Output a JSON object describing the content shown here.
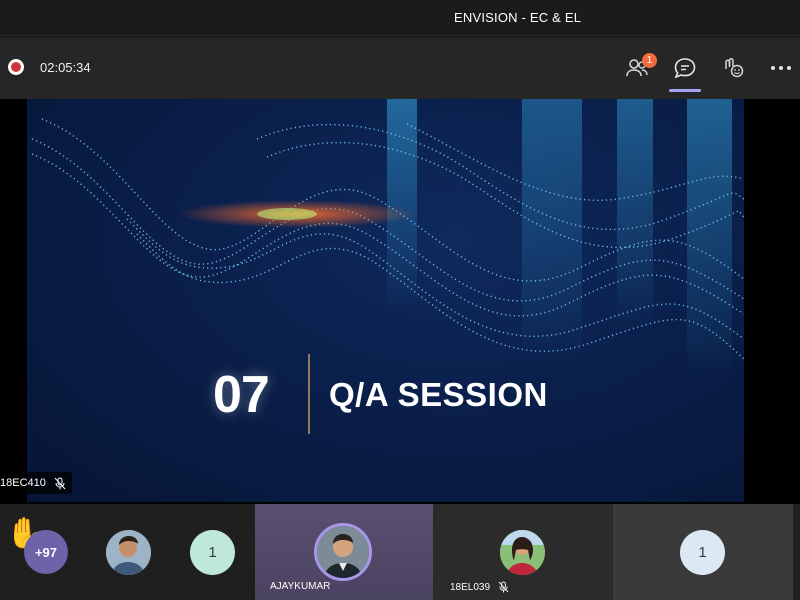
{
  "window": {
    "title": "ENVISION - EC & EL"
  },
  "toolbar": {
    "recording_time": "02:05:34",
    "people_badge": "1",
    "icons": [
      "record-icon",
      "people-icon",
      "chat-icon",
      "reactions-icon",
      "more-icon"
    ]
  },
  "stage": {
    "slide": {
      "number": "07",
      "title": "Q/A SESSION"
    },
    "presenter_tag": "18EC410"
  },
  "participants": {
    "raised_hand_count": "+97",
    "tiles": [
      {
        "label": "",
        "count": "1"
      },
      {
        "label": "AJAYKUMAR"
      },
      {
        "label": "18EL039"
      },
      {
        "label": "",
        "count": "1"
      }
    ]
  },
  "colors": {
    "accent": "#a6a3f5",
    "record": "#d13438",
    "badge": "#f36a3b",
    "slide_bg": "#0a1f4a"
  }
}
